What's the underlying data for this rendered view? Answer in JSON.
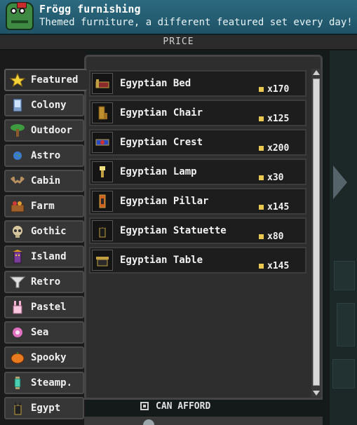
{
  "header": {
    "title": "Frögg furnishing",
    "subtitle": "Themed furniture, a different featured set every day!",
    "avatar_icon": "frog-merchant-icon"
  },
  "price_header": "PRICE",
  "tabs": [
    {
      "label": "Featured",
      "icon": "star-icon",
      "active": true
    },
    {
      "label": "Colony",
      "icon": "phone-icon",
      "active": false
    },
    {
      "label": "Outdoor",
      "icon": "palm-tree-icon",
      "active": false
    },
    {
      "label": "Astro",
      "icon": "globe-icon",
      "active": false
    },
    {
      "label": "Cabin",
      "icon": "antlers-icon",
      "active": false
    },
    {
      "label": "Farm",
      "icon": "basket-icon",
      "active": false
    },
    {
      "label": "Gothic",
      "icon": "skull-icon",
      "active": false
    },
    {
      "label": "Island",
      "icon": "tiki-icon",
      "active": false
    },
    {
      "label": "Retro",
      "icon": "funnel-icon",
      "active": false
    },
    {
      "label": "Pastel",
      "icon": "bunny-icon",
      "active": false
    },
    {
      "label": "Sea",
      "icon": "sea-flower-icon",
      "active": false
    },
    {
      "label": "Spooky",
      "icon": "pumpkin-icon",
      "active": false
    },
    {
      "label": "Steamp.",
      "icon": "lantern-icon",
      "active": false
    },
    {
      "label": "Egypt",
      "icon": "anubis-icon",
      "active": false
    }
  ],
  "items": [
    {
      "name": "Egyptian Bed",
      "price": "x170",
      "icon": "bed-icon"
    },
    {
      "name": "Egyptian Chair",
      "price": "x125",
      "icon": "chair-icon"
    },
    {
      "name": "Egyptian Crest",
      "price": "x200",
      "icon": "crest-icon"
    },
    {
      "name": "Egyptian Lamp",
      "price": "x30",
      "icon": "lamp-icon"
    },
    {
      "name": "Egyptian Pillar",
      "price": "x145",
      "icon": "pillar-icon"
    },
    {
      "name": "Egyptian Statuette",
      "price": "x80",
      "icon": "statuette-icon"
    },
    {
      "name": "Egyptian Table",
      "price": "x145",
      "icon": "table-icon"
    }
  ],
  "afford_filter": {
    "label": "CAN AFFORD",
    "checked": false
  },
  "colors": {
    "header": "#2c6a80",
    "pixel_coin": "#e8c850",
    "panel": "#2e2e2e"
  }
}
